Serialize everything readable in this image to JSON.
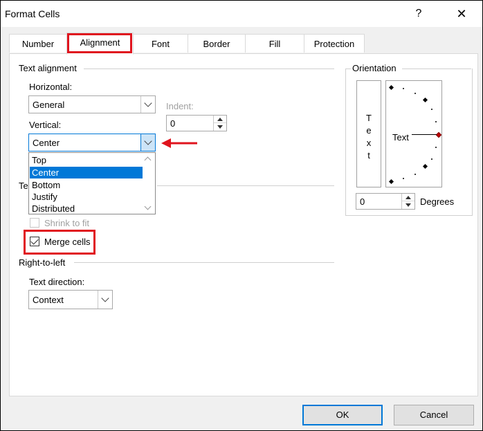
{
  "window": {
    "title": "Format Cells",
    "help_glyph": "?",
    "close_glyph": "✕"
  },
  "tabs": [
    {
      "label": "Number"
    },
    {
      "label": "Alignment"
    },
    {
      "label": "Font"
    },
    {
      "label": "Border"
    },
    {
      "label": "Fill"
    },
    {
      "label": "Protection"
    }
  ],
  "text_alignment": {
    "group_label": "Text alignment",
    "horizontal_label": "Horizontal:",
    "horizontal_value": "General",
    "vertical_label": "Vertical:",
    "vertical_value": "Center",
    "indent_label": "Indent:",
    "indent_value": "0",
    "vertical_options": [
      "Top",
      "Center",
      "Bottom",
      "Justify",
      "Distributed"
    ]
  },
  "text_control": {
    "group_label_partial": "Te",
    "shrink_to_fit_label": "Shrink to fit",
    "merge_cells_label": "Merge cells",
    "merge_cells_checked": true
  },
  "right_to_left": {
    "group_label": "Right-to-left",
    "text_direction_label": "Text direction:",
    "text_direction_value": "Context"
  },
  "orientation": {
    "group_label": "Orientation",
    "vertical_letters": [
      "T",
      "e",
      "x",
      "t"
    ],
    "dial_text": "Text",
    "degrees_value": "0",
    "degrees_label": "Degrees"
  },
  "buttons": {
    "ok_label": "OK",
    "cancel_label": "Cancel"
  },
  "colors": {
    "annotation_red": "#e0141e",
    "selection_blue": "#0078d7"
  }
}
